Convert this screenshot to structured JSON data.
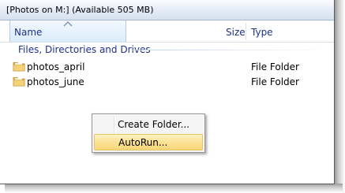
{
  "path_bar": {
    "text": "[Photos on M:]  (Available 505 MB)"
  },
  "columns": {
    "name": "Name",
    "size": "Size",
    "type": "Type",
    "sort_icon": "sort-ascending-icon"
  },
  "group": {
    "title": "Files, Directories and Drives"
  },
  "rows": [
    {
      "name": "photos_april",
      "size": "",
      "type": "File Folder",
      "icon": "folder-icon"
    },
    {
      "name": "photos_june",
      "size": "",
      "type": "File Folder",
      "icon": "folder-icon"
    }
  ],
  "context_menu": {
    "items": [
      {
        "label": "Create Folder...",
        "highlighted": false
      },
      {
        "label": "AutoRun...",
        "highlighted": true
      }
    ]
  },
  "colors": {
    "header_text": "#1e3287",
    "folder_yellow": "#e8c053",
    "menu_highlight": "#fbe295"
  }
}
